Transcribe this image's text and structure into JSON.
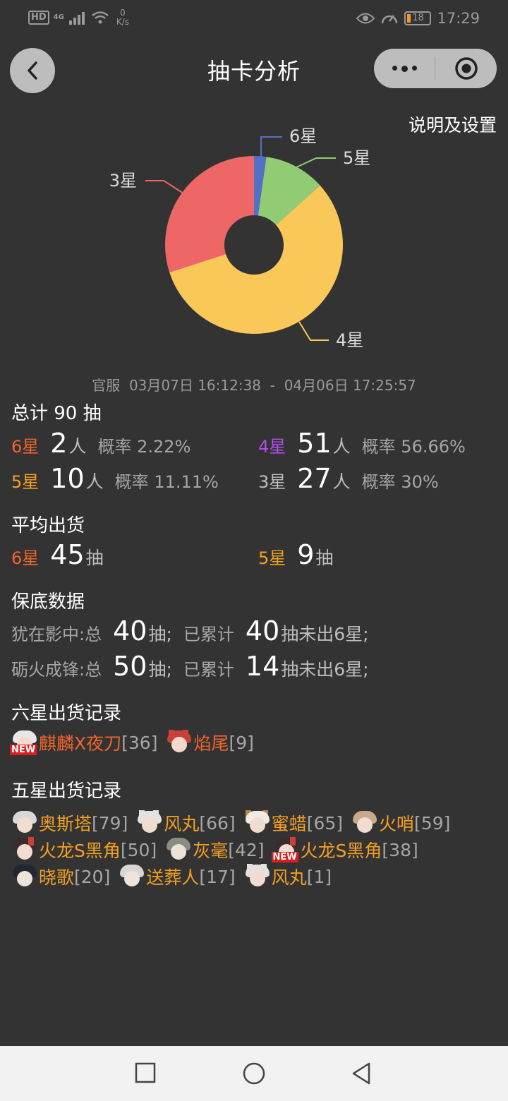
{
  "status_bar": {
    "hd": "HD",
    "network": "4G",
    "speed_value": "0",
    "speed_unit": "K/s",
    "battery": "18",
    "time": "17:29"
  },
  "header": {
    "title": "抽卡分析",
    "settings_label": "说明及设置"
  },
  "chart_data": {
    "type": "pie",
    "donut": true,
    "categories": [
      "6星",
      "5星",
      "4星",
      "3星"
    ],
    "values": [
      2,
      10,
      51,
      27
    ],
    "colors": [
      "#5470c6",
      "#91cc75",
      "#fac858",
      "#ee6666"
    ]
  },
  "range": {
    "server": "官服",
    "start": "03月07日 16:12:38",
    "sep": "-",
    "end": "04月06日 17:25:57"
  },
  "summary": {
    "total_label": "总计 90 抽",
    "unit_people": "人",
    "prob_label": "概率",
    "stars": [
      {
        "label": "6星",
        "count": "2",
        "prob": "2.22%",
        "color": "#f0642a"
      },
      {
        "label": "4星",
        "count": "51",
        "prob": "56.66%",
        "color": "#b44bf0"
      },
      {
        "label": "5星",
        "count": "10",
        "prob": "11.11%",
        "color": "#f4a024"
      },
      {
        "label": "3星",
        "count": "27",
        "prob": "30%",
        "color": "#bdbdbd"
      }
    ]
  },
  "average": {
    "title": "平均出货",
    "unit": "抽",
    "items": [
      {
        "label": "6星",
        "value": "45"
      },
      {
        "label": "5星",
        "value": "9"
      }
    ]
  },
  "pity": {
    "title": "保底数据",
    "rows": [
      {
        "pool": "犹在影中:总",
        "total": "40",
        "unit1": "抽;",
        "accum_label": "已累计",
        "accum": "40",
        "unit2": "抽未出6星;"
      },
      {
        "pool": "砺火成锋:总",
        "total": "50",
        "unit1": "抽;",
        "accum_label": "已累计",
        "accum": "14",
        "unit2": "抽未出6星;"
      }
    ]
  },
  "six_star": {
    "title": "六星出货记录",
    "new_tag": "NEW",
    "records": [
      {
        "name": "麒麟X夜刀",
        "count": "[36]",
        "is_new": true
      },
      {
        "name": "焰尾",
        "count": "[9]",
        "is_new": false
      }
    ]
  },
  "five_star": {
    "title": "五星出货记录",
    "records": [
      {
        "name": "奥斯塔",
        "count": "[79]"
      },
      {
        "name": "风丸",
        "count": "[66]"
      },
      {
        "name": "蜜蜡",
        "count": "[65]"
      },
      {
        "name": "火哨",
        "count": "[59]"
      },
      {
        "name": "火龙S黑角",
        "count": "[50]"
      },
      {
        "name": "灰毫",
        "count": "[42]"
      },
      {
        "name": "火龙S黑角",
        "count": "[38]",
        "is_new": true
      },
      {
        "name": "晓歌",
        "count": "[20]"
      },
      {
        "name": "送葬人",
        "count": "[17]"
      },
      {
        "name": "风丸",
        "count": "[1]"
      }
    ]
  }
}
